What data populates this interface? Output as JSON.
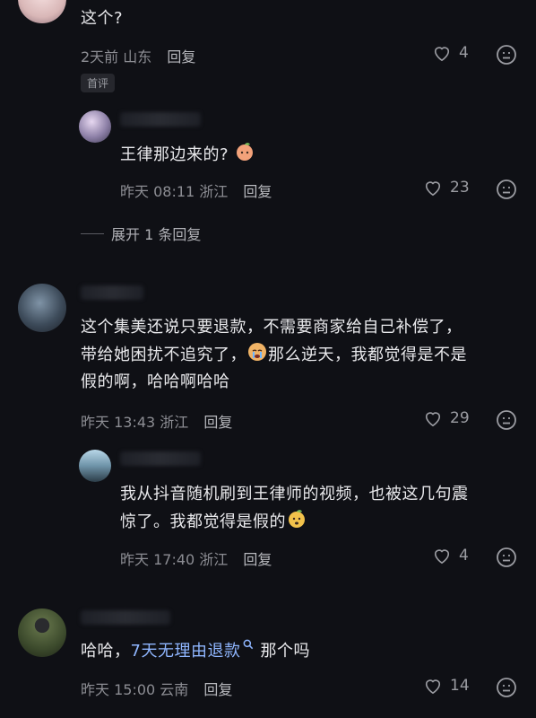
{
  "comments": [
    {
      "text": "这个?",
      "time": "2天前",
      "location": "山东",
      "reply_label": "回复",
      "likes": "4",
      "tag": "首评"
    },
    {
      "text": "王律那边来的?",
      "time": "昨天 08:11",
      "location": "浙江",
      "reply_label": "回复",
      "likes": "23"
    },
    {
      "expand_label": "展开 1 条回复"
    },
    {
      "line1": "这个集美还说只要退款，不需要商家给自己补偿了，",
      "line2a": "带给她困扰不追究了，",
      "line2b": "那么逆天，我都觉得是不是",
      "line3": "假的啊，哈哈啊哈哈",
      "time": "昨天 13:43",
      "location": "浙江",
      "reply_label": "回复",
      "likes": "29"
    },
    {
      "line1": "我从抖音随机刷到王律师的视频，也被这几句震",
      "line2": "惊了。我都觉得是假的",
      "time": "昨天 17:40",
      "location": "浙江",
      "reply_label": "回复",
      "likes": "4"
    },
    {
      "prefix": "哈哈，",
      "link": "7天无理由退款",
      "suffix": "那个吗",
      "time": "昨天 15:00",
      "location": "云南",
      "reply_label": "回复",
      "likes": "14"
    }
  ],
  "colors": {
    "background": "#0f1015",
    "link": "#8fb6ff",
    "meta": "#8c8d93"
  },
  "icons": {
    "like": "heart-icon",
    "dislike": "neutral-face-icon",
    "search": "search-icon"
  }
}
